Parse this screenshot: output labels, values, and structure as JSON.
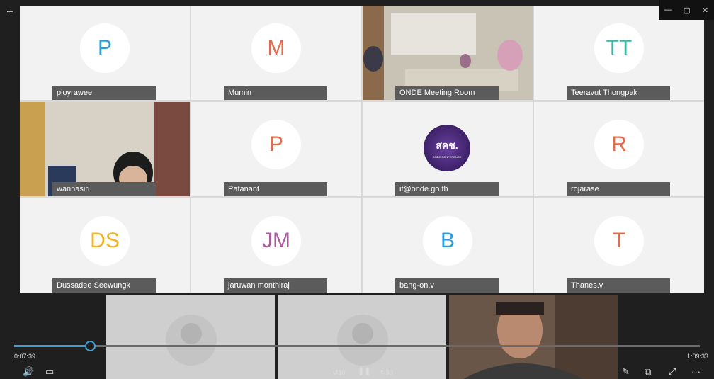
{
  "window": {
    "back_icon": "←",
    "min": "—",
    "max": "▢",
    "close": "✕"
  },
  "tiles": [
    {
      "name": "ployrawee",
      "initials": "P",
      "color": "#2b9be0"
    },
    {
      "name": "Mumin",
      "initials": "M",
      "color": "#e8694a"
    },
    {
      "name": "ONDE Meeting Room",
      "initials": "",
      "color": "#999"
    },
    {
      "name": "Teeravut Thongpak",
      "initials": "TT",
      "color": "#3ab7a2"
    },
    {
      "name": "wannasiri",
      "initials": "",
      "color": "#999"
    },
    {
      "name": "Patanant",
      "initials": "P",
      "color": "#e8694a"
    },
    {
      "name": "it@onde.go.th",
      "initials": "",
      "color": "#999"
    },
    {
      "name": "rojarase",
      "initials": "R",
      "color": "#e8694a"
    },
    {
      "name": "Dussadee Seewungk",
      "initials": "DS",
      "color": "#f0b429"
    },
    {
      "name": "jaruwan monthiraj",
      "initials": "JM",
      "color": "#b05aa0"
    },
    {
      "name": "bang-on.v",
      "initials": "B",
      "color": "#2b9be0"
    },
    {
      "name": "Thanes.v",
      "initials": "T",
      "color": "#e8694a"
    }
  ],
  "logo": {
    "main_text": "สคช.",
    "sub_text": "ONDE CONFERENCE"
  },
  "player": {
    "elapsed": "0:07:39",
    "total": "1:09:33",
    "progress_fraction": 0.11,
    "volume_icon": "🔊",
    "captions_icon": "▭",
    "rewind_label": "10",
    "pause_icon": "❚❚",
    "forward_label": "30",
    "edit_icon": "✎",
    "pip_icon": "⧉",
    "fullscreen_icon": "⤢",
    "more_icon": "···"
  }
}
